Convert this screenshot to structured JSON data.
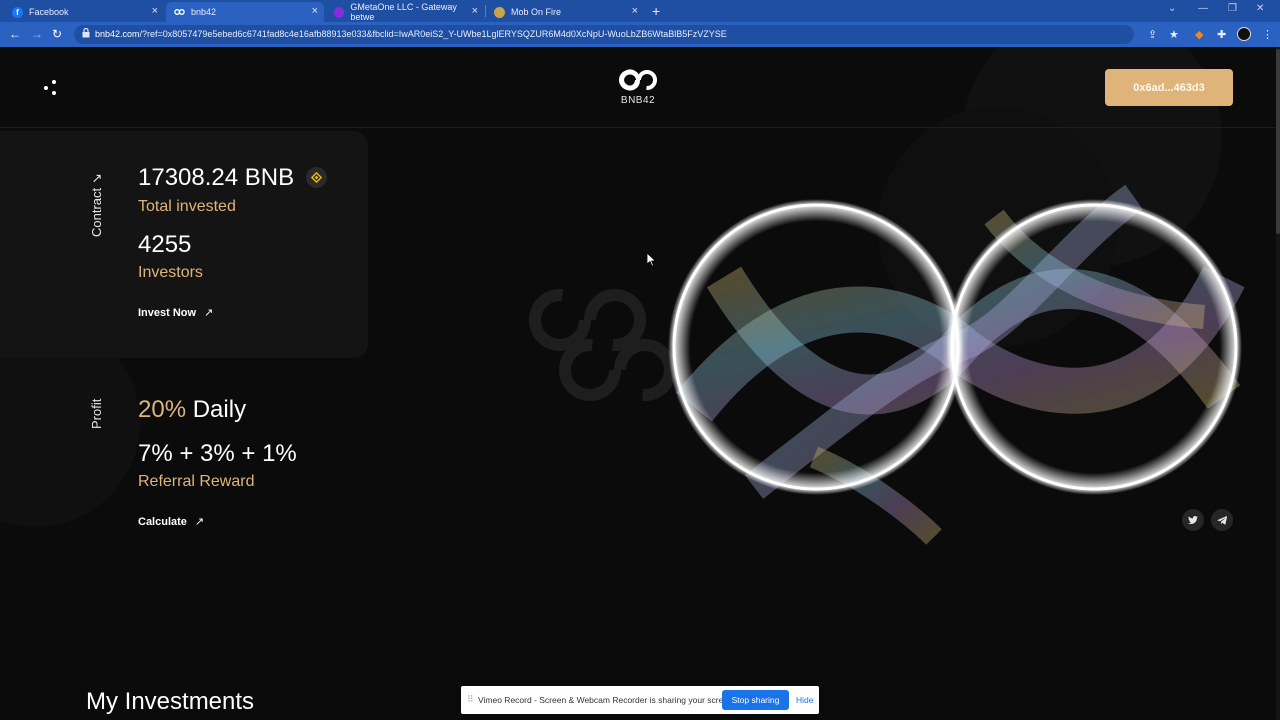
{
  "browser": {
    "tabs": [
      {
        "title": "Facebook",
        "icon": "facebook-icon"
      },
      {
        "title": "bnb42",
        "icon": "bnb42-logo-icon"
      },
      {
        "title": "GMetaOne LLC - Gateway betwe",
        "icon": "gmetaone-icon"
      },
      {
        "title": "Mob On Fire",
        "icon": "mob-on-fire-icon"
      }
    ],
    "active_tab": 1,
    "url_host": "bnb42.com",
    "url_rest": "/?ref=0x8057479e5ebed6c6741fad8c4e16afb88913e033&fbclid=IwAR0eiS2_Y-UWbe1LglERYSQZUR6M4d0XcNpU-WuoLbZB6WtaBlB5FzVZYSE"
  },
  "header": {
    "logo_text": "BNB42",
    "wallet_label": "0x6ad...463d3"
  },
  "contract": {
    "section_label": "Contract",
    "total_invested": "17308.24 BNB",
    "total_invested_label": "Total invested",
    "investors": "4255",
    "investors_label": "Investors",
    "invest_link": "Invest Now"
  },
  "profit": {
    "section_label": "Profit",
    "daily_pct": "20%",
    "daily_word": "Daily",
    "referral_values": "7% + 3% + 1%",
    "referral_label": "Referral Reward",
    "calc_link": "Calculate"
  },
  "investments": {
    "title": "My Investments"
  },
  "share_notice": {
    "message": "Vimeo Record - Screen & Webcam Recorder is sharing your screen.",
    "stop_label": "Stop sharing",
    "hide_label": "Hide"
  },
  "colors": {
    "accent_gold": "#dfb47a",
    "background": "#0b0b0b",
    "browser_blue": "#2b62c2"
  }
}
